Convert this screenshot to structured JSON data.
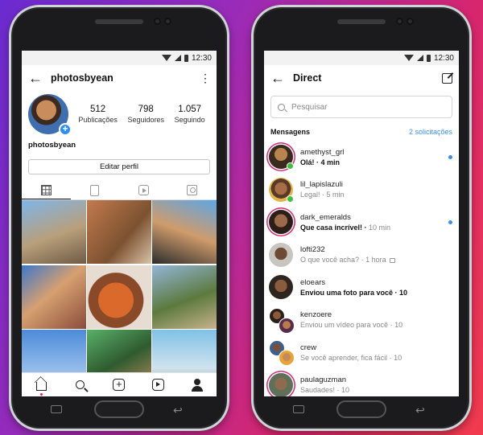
{
  "colors": {
    "accent": "#3b8fe8",
    "ring": "#d62976",
    "online": "#3fbf3f"
  },
  "status": {
    "time": "12:30"
  },
  "profile": {
    "back_icon": "arrow-left-icon",
    "username": "photosbyean",
    "menu_icon": "more-vertical-icon",
    "display_name": "photosbyean",
    "stats": [
      {
        "value": "512",
        "label": "Publicações"
      },
      {
        "value": "798",
        "label": "Seguidores"
      },
      {
        "value": "1.057",
        "label": "Seguindo"
      }
    ],
    "edit_button": "Editar perfil",
    "tabs": [
      "grid-icon",
      "igtv-icon",
      "reels-icon",
      "tagged-icon"
    ],
    "photos_count_shown": 9
  },
  "bottom_nav": [
    "home-icon",
    "search-icon",
    "new-post-icon",
    "reels-icon",
    "profile-icon"
  ],
  "direct": {
    "title": "Direct",
    "search_placeholder": "Pesquisar",
    "section_title": "Mensagens",
    "requests_link": "2 solicitações",
    "threads": [
      {
        "name": "amethyst_grl",
        "preview": "Olá!",
        "time": "4 min",
        "unread": true,
        "online": true,
        "story": true
      },
      {
        "name": "lil_lapislazuli",
        "preview": "Legal!",
        "time": "5 min",
        "unread": false,
        "online": true,
        "story": false
      },
      {
        "name": "dark_emeralds",
        "preview": "Que casa incrível!",
        "time": "10 min",
        "unread": true,
        "online": false,
        "story": true
      },
      {
        "name": "lofti232",
        "preview": "O que você acha?",
        "time": "1 hora",
        "unread": false,
        "online": false,
        "story": false,
        "muted": true
      },
      {
        "name": "eloears",
        "preview": "Enviou uma foto para você",
        "time": "10",
        "unread": true,
        "online": false,
        "story": false
      },
      {
        "name": "kenzoere",
        "preview": "Enviou um vídeo para você",
        "time": "10",
        "unread": false,
        "online": false,
        "story": false
      },
      {
        "name": "crew",
        "preview": "Se você aprender, fica fácil",
        "time": "10",
        "unread": false,
        "online": false,
        "story": false
      },
      {
        "name": "paulaguzman",
        "preview": "Saudades!",
        "time": "10",
        "unread": false,
        "online": false,
        "story": true
      }
    ]
  }
}
